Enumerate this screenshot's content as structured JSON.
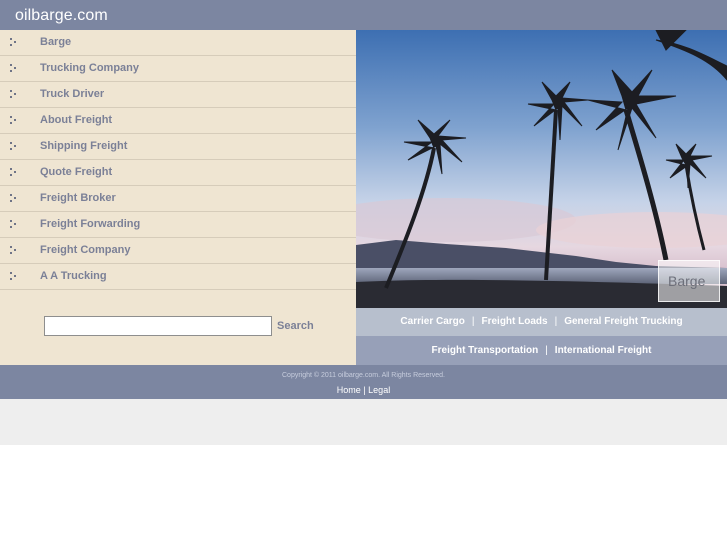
{
  "header": {
    "site_title": "oilbarge.com"
  },
  "sidebar": {
    "items": [
      {
        "label": "Barge"
      },
      {
        "label": "Trucking Company"
      },
      {
        "label": "Truck Driver"
      },
      {
        "label": "About Freight"
      },
      {
        "label": "Shipping Freight"
      },
      {
        "label": "Quote Freight"
      },
      {
        "label": "Freight Broker"
      },
      {
        "label": "Freight Forwarding"
      },
      {
        "label": "Freight Company"
      },
      {
        "label": "A A Trucking"
      }
    ]
  },
  "search": {
    "value": "",
    "button_label": "Search"
  },
  "hero": {
    "badge_text": "Barge"
  },
  "links_row_1": [
    {
      "label": "Carrier Cargo"
    },
    {
      "label": "Freight Loads"
    },
    {
      "label": "General Freight Trucking"
    }
  ],
  "links_row_2": [
    {
      "label": "Freight Transportation"
    },
    {
      "label": "International Freight"
    }
  ],
  "link_separator": "|",
  "footer": {
    "copyright": "Copyright © 2011 oilbarge.com. All Rights Reserved.",
    "home_label": "Home",
    "separator": "|",
    "legal_label": "Legal"
  },
  "colors": {
    "header_bg": "#7c86a1",
    "sidebar_bg": "#efe5d2",
    "nav_text": "#7b8097",
    "links_row_1_bg": "#b7bfcd",
    "links_row_2_bg": "#97a0b8"
  }
}
